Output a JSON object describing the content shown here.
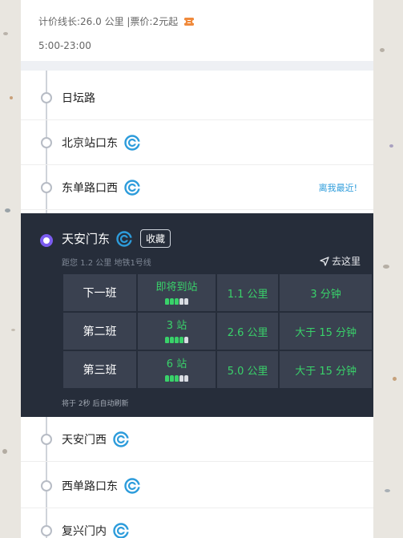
{
  "route_info": {
    "line1": "计价线长:26.0 公里 |票价:2元起",
    "hours": "5:00-23:00"
  },
  "stations_before": [
    {
      "name": "日坛路",
      "has_metro": false
    },
    {
      "name": "北京站口东",
      "has_metro": true
    },
    {
      "name": "东单路口西",
      "has_metro": true,
      "badge": "离我最近!"
    }
  ],
  "active_station": {
    "name": "天安门东",
    "fav_label": "收藏",
    "subtitle": "距您 1.2 公里  地铁1号线",
    "goto_label": "去这里",
    "arrivals": [
      {
        "label": "下一班",
        "stops": "即将到站",
        "distance": "1.1 公里",
        "eta": "3 分钟",
        "crowd": [
          1,
          1,
          1,
          0,
          0
        ]
      },
      {
        "label": "第二班",
        "stops": "3 站",
        "distance": "2.6 公里",
        "eta": "大于 15 分钟",
        "crowd": [
          1,
          1,
          1,
          1,
          0
        ]
      },
      {
        "label": "第三班",
        "stops": "6 站",
        "distance": "5.0 公里",
        "eta": "大于 15 分钟",
        "crowd": [
          1,
          1,
          1,
          0,
          0
        ]
      }
    ],
    "refresh_note": "将于 2秒 后自动刷新"
  },
  "stations_after": [
    {
      "name": "天安门西",
      "has_metro": true
    },
    {
      "name": "西单路口东",
      "has_metro": true
    },
    {
      "name": "复兴门内",
      "has_metro": true
    }
  ],
  "colors": {
    "accent_blue": "#2d9cdb",
    "crowd_green": "#39d26a",
    "active_bg": "#262d3a",
    "active_dot": "#7b5cf0",
    "ticket_orange": "#f08a3c"
  }
}
